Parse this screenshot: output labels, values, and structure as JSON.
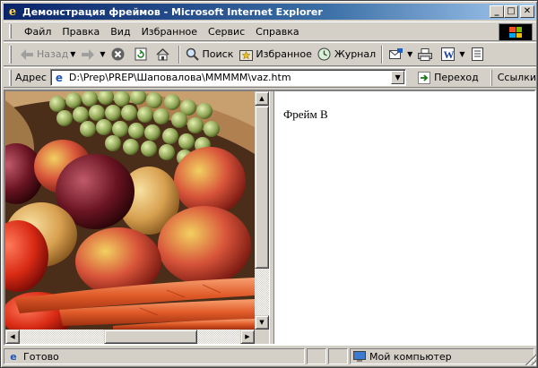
{
  "window": {
    "title": "Демонстрация фреймов - Microsoft Internet Explorer",
    "title_bar_color": "#0a246a"
  },
  "title_buttons": {
    "minimize_glyph": "_",
    "maximize_glyph": "□",
    "close_glyph": "✕"
  },
  "menu": {
    "items": [
      {
        "label": "Файл"
      },
      {
        "label": "Правка"
      },
      {
        "label": "Вид"
      },
      {
        "label": "Избранное"
      },
      {
        "label": "Сервис"
      },
      {
        "label": "Справка"
      }
    ]
  },
  "toolbar": {
    "back_label": "Назад",
    "search_label": "Поиск",
    "favorites_label": "Избранное",
    "history_label": "Журнал",
    "icons": {
      "back": "back-arrow-icon",
      "forward": "forward-arrow-icon",
      "stop": "stop-icon",
      "refresh": "refresh-icon",
      "home": "home-icon",
      "search": "search-icon",
      "favorites": "favorites-icon",
      "history": "history-icon",
      "mail": "mail-icon",
      "print": "print-icon",
      "edit": "edit-icon",
      "discuss": "discuss-icon"
    }
  },
  "address": {
    "label": "Адрес",
    "url": "D:\\Prep\\PREP\\Шаповалова\\MMMMM\\vaz.htm",
    "go_label": "Переход",
    "links_label": "Ссылки"
  },
  "frames": {
    "frame_b_text": "Фрейм В"
  },
  "status": {
    "text": "Готово",
    "zone": "Мой компьютер"
  },
  "colors": {
    "chrome": "#d4d0c8",
    "title_gradient_end": "#a6caf0"
  }
}
